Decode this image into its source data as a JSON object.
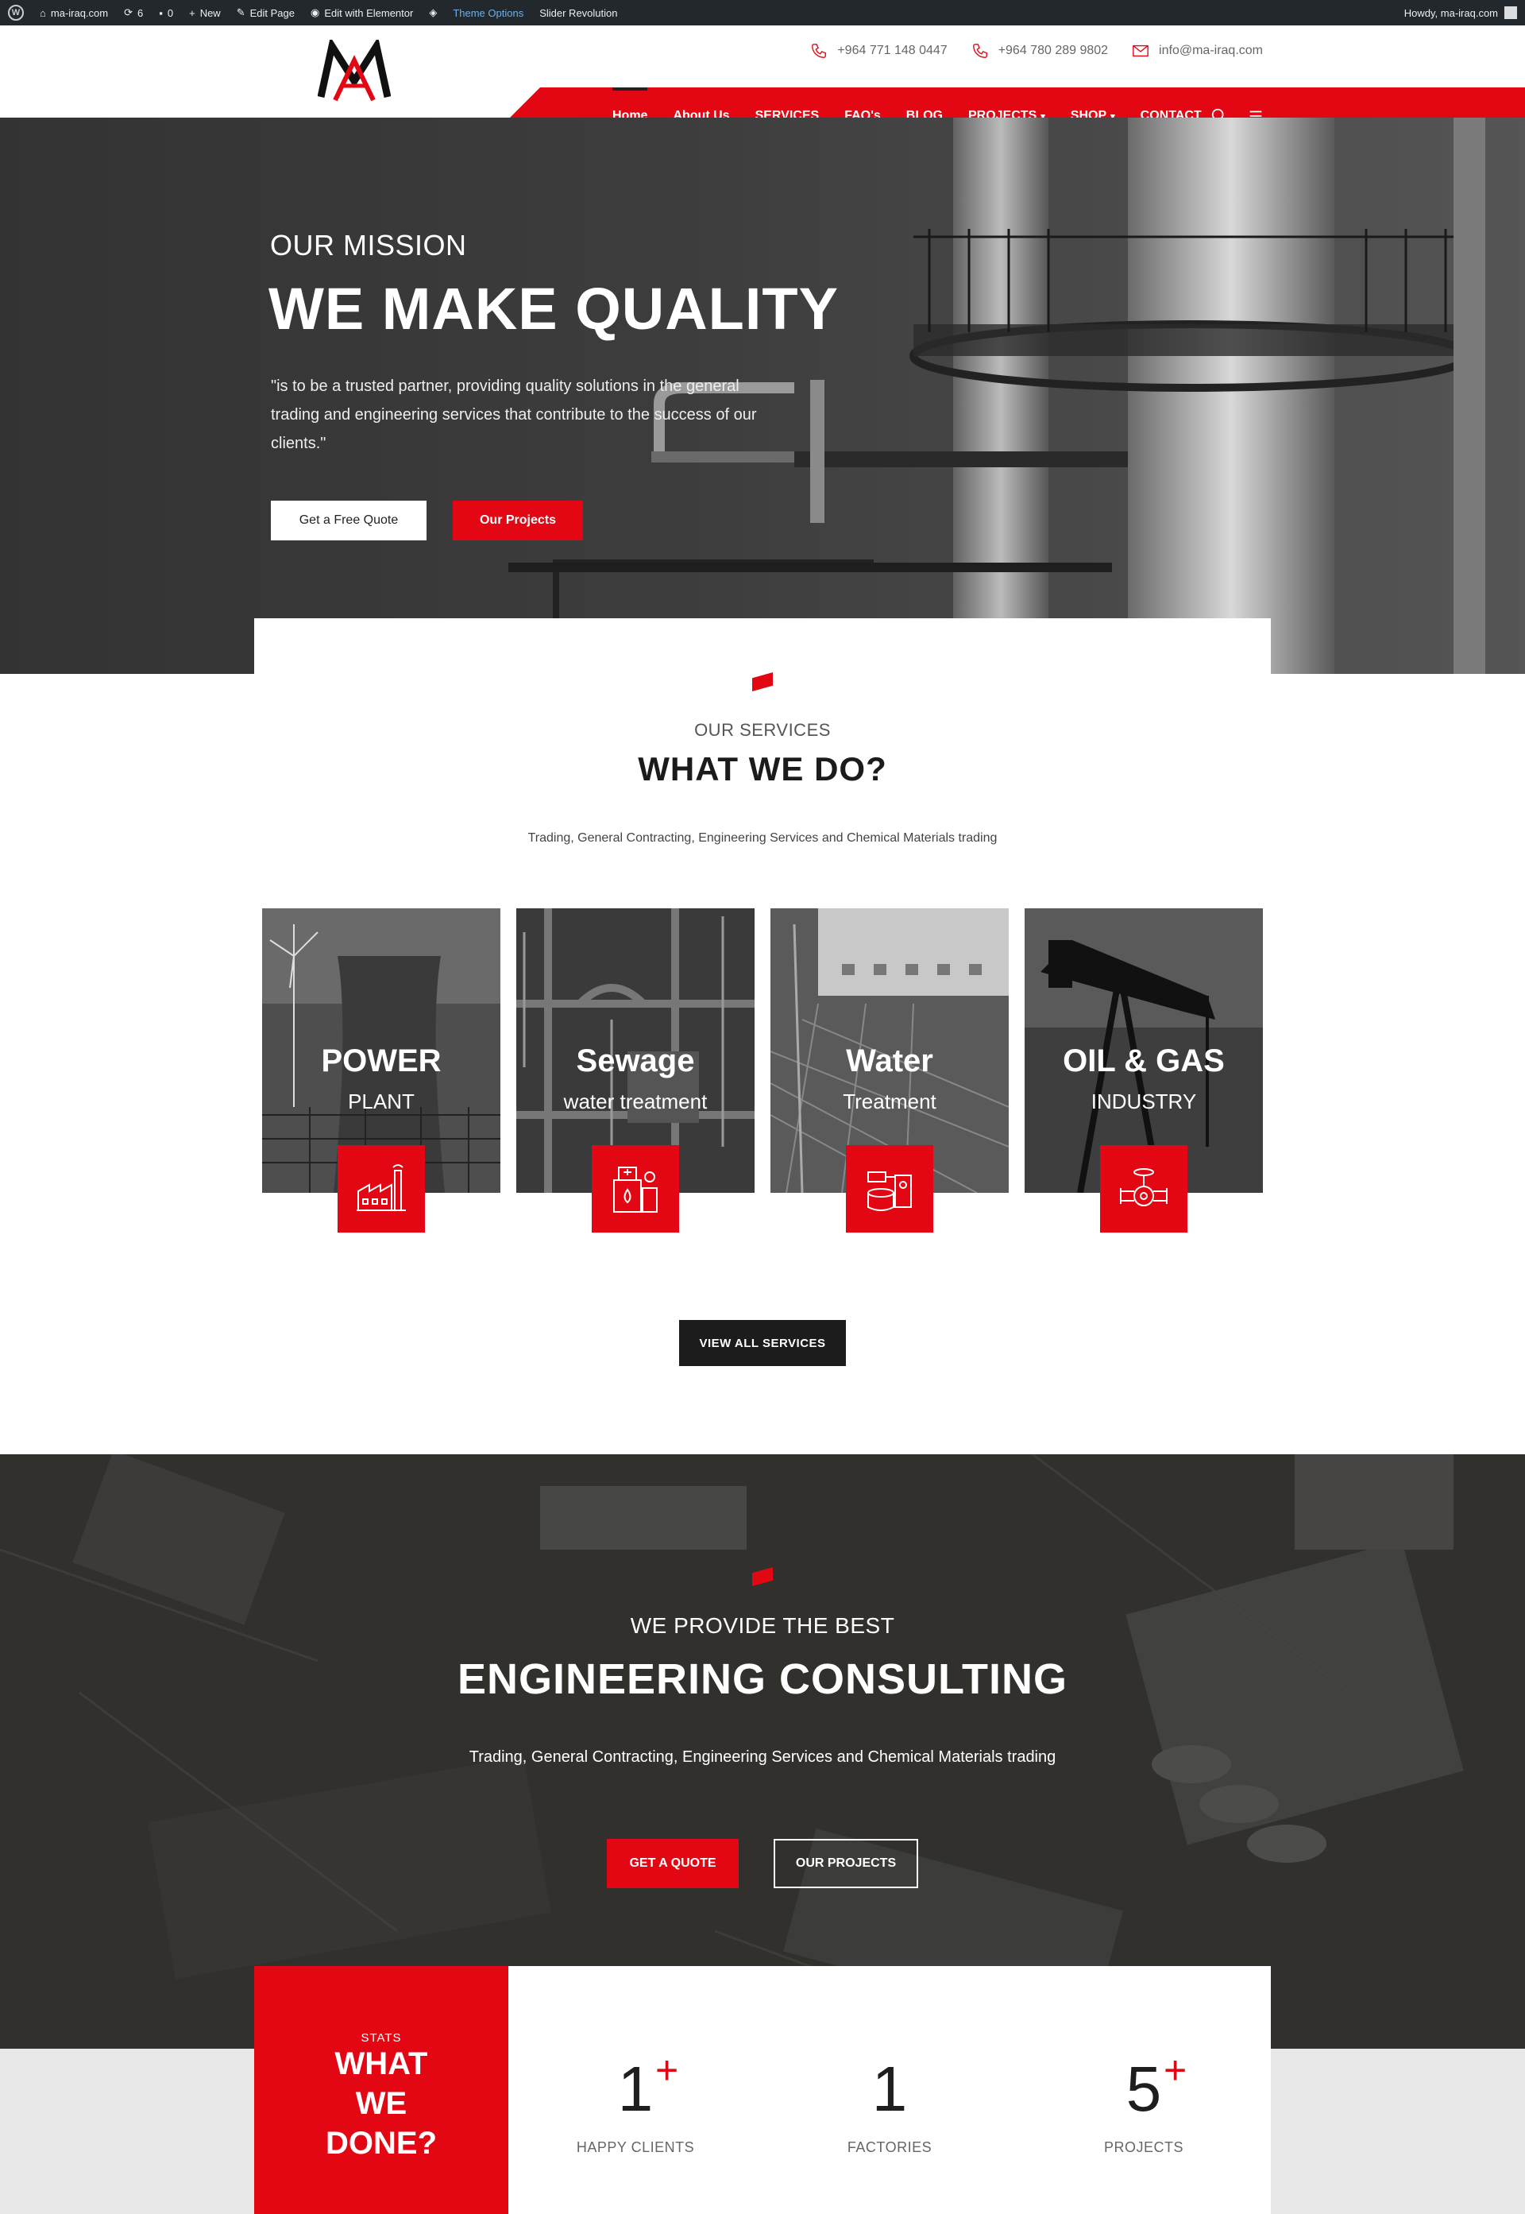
{
  "admin_bar": {
    "site": "ma-iraq.com",
    "updates": "6",
    "comments": "0",
    "new": "New",
    "edit_page": "Edit Page",
    "edit_elementor": "Edit with Elementor",
    "theme_options": "Theme Options",
    "slider": "Slider Revolution",
    "howdy": "Howdy, ma-iraq.com"
  },
  "header": {
    "phone1": "+964 771 148 0447",
    "phone2": "+964 780 289 9802",
    "email": "info@ma-iraq.com"
  },
  "nav": {
    "items": [
      {
        "label": "Home"
      },
      {
        "label": "About Us"
      },
      {
        "label": "SERVICES"
      },
      {
        "label": "FAQ's"
      },
      {
        "label": "BLOG"
      },
      {
        "label": "PROJECTS"
      },
      {
        "label": "SHOP"
      },
      {
        "label": "CONTACT"
      }
    ]
  },
  "hero": {
    "subtitle": "OUR MISSION",
    "title": "WE MAKE QUALITY",
    "quote": "\"is to be a trusted partner, providing quality solutions in the general trading and engineering services that contribute to the success of our clients.\"",
    "btn_quote": "Get a Free Quote",
    "btn_projects": "Our Projects"
  },
  "services": {
    "subtitle": "OUR SERVICES",
    "title": "WHAT WE DO?",
    "description": "Trading, General Contracting, Engineering Services and Chemical Materials trading",
    "cards": [
      {
        "title": "POWER",
        "subtitle": "PLANT",
        "icon": "factory-icon"
      },
      {
        "title": "Sewage",
        "subtitle": "water treatment",
        "icon": "water-treatment-icon"
      },
      {
        "title": "Water",
        "subtitle": "Treatment",
        "icon": "tank-icon"
      },
      {
        "title": "OIL & GAS",
        "subtitle": "INDUSTRY",
        "icon": "valve-icon"
      }
    ],
    "view_all": "VIEW ALL SERVICES"
  },
  "consulting": {
    "subtitle": "WE PROVIDE THE BEST",
    "title": "ENGINEERING CONSULTING",
    "description": "Trading, General Contracting, Engineering Services and Chemical Materials trading",
    "btn_quote": "GET A QUOTE",
    "btn_projects": "OUR PROJECTS"
  },
  "stats": {
    "label": "STATS",
    "heading_1": "WHAT",
    "heading_2": "WE",
    "heading_3": "DONE?",
    "items": [
      {
        "value": "1",
        "plus": "+",
        "caption": "HAPPY CLIENTS"
      },
      {
        "value": "1",
        "plus": "",
        "caption": "FACTORIES"
      },
      {
        "value": "5",
        "plus": "+",
        "caption": "PROJECTS"
      }
    ]
  },
  "colors": {
    "accent": "#e30613",
    "dark": "#1c1c1c",
    "admin_bar": "#23282d"
  }
}
